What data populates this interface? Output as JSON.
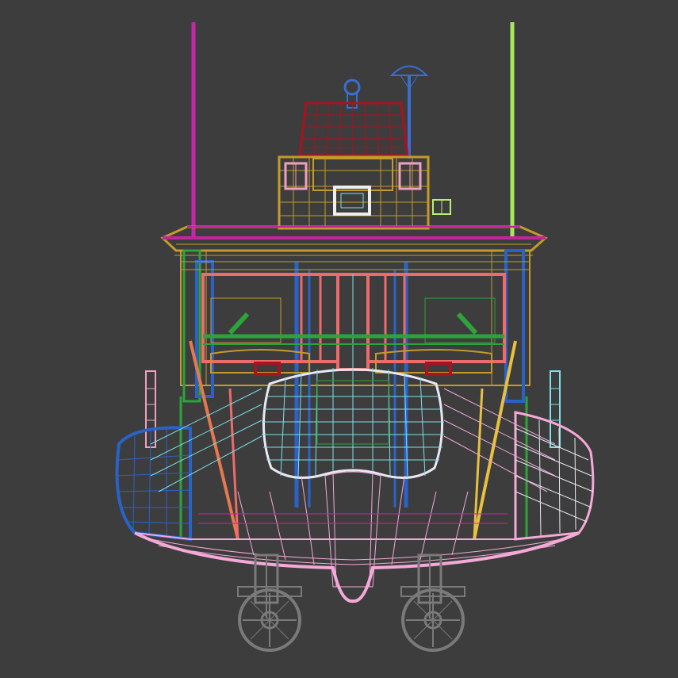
{
  "viewport": {
    "background": "#3d3d3d",
    "model": "boat-wireframe-front-view"
  },
  "palette": {
    "hull_pink": "#f4a9d8",
    "tube_blue": "#2a62c8",
    "tube_white": "#e8e8f4",
    "cabin_gold": "#c49a2a",
    "roof_magenta": "#c0269a",
    "window_salmon": "#ee6b6b",
    "mast_magenta": "#c626a8",
    "mast_green": "#a6e85a",
    "radar_red": "#a8141e",
    "fender_cyan": "#7ee0e8",
    "frame_green": "#2da43a",
    "strut_yellow": "#e8c040",
    "strut_orange": "#e87850",
    "light_pink": "#f0a0c0",
    "antenna_blue": "#3a6ed0",
    "sensor_green": "#b8f070",
    "panel_white": "#eeeeee",
    "propeller_grey": "#7a7a7a"
  },
  "icons": {
    "radar_dome": "radar-icon",
    "antenna": "antenna-icon",
    "propeller": "propeller-icon"
  }
}
